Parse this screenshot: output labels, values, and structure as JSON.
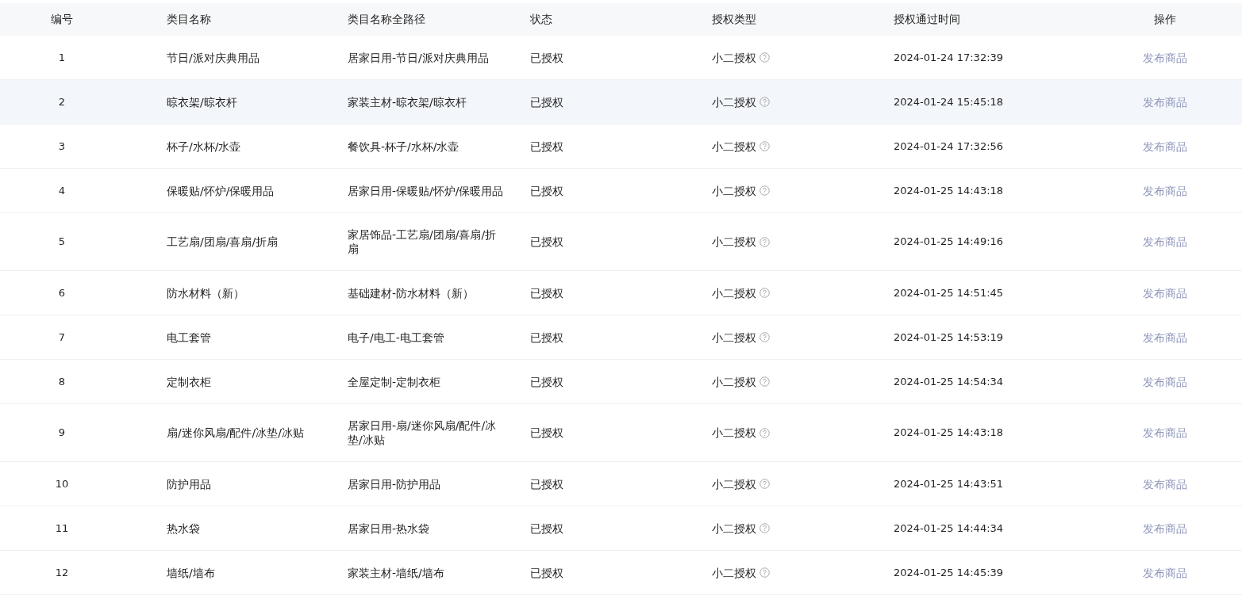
{
  "table": {
    "columns": [
      "编号",
      "类目名称",
      "类目名称全路径",
      "状态",
      "授权类型",
      "授权通过时间",
      "操作"
    ],
    "rows": [
      {
        "number": "1",
        "category": "节日/派对庆典用品",
        "path": "居家日用-节日/派对庆典用品",
        "status": "已授权",
        "auth_type": "小二授权",
        "time": "2024-01-24 17:32:39",
        "action": "发布商品",
        "hovered": false
      },
      {
        "number": "2",
        "category": "晾衣架/晾衣杆",
        "path": "家装主材-晾衣架/晾衣杆",
        "status": "已授权",
        "auth_type": "小二授权",
        "time": "2024-01-24 15:45:18",
        "action": "发布商品",
        "hovered": true
      },
      {
        "number": "3",
        "category": "杯子/水杯/水壶",
        "path": "餐饮具-杯子/水杯/水壶",
        "status": "已授权",
        "auth_type": "小二授权",
        "time": "2024-01-24 17:32:56",
        "action": "发布商品",
        "hovered": false
      },
      {
        "number": "4",
        "category": "保暖贴/怀炉/保暖用品",
        "path": "居家日用-保暖贴/怀炉/保暖用品",
        "status": "已授权",
        "auth_type": "小二授权",
        "time": "2024-01-25 14:43:18",
        "action": "发布商品",
        "hovered": false
      },
      {
        "number": "5",
        "category": "工艺扇/团扇/喜扇/折扇",
        "path": "家居饰品-工艺扇/团扇/喜扇/折扇",
        "status": "已授权",
        "auth_type": "小二授权",
        "time": "2024-01-25 14:49:16",
        "action": "发布商品",
        "hovered": false
      },
      {
        "number": "6",
        "category": "防水材料（新）",
        "path": "基础建材-防水材料（新）",
        "status": "已授权",
        "auth_type": "小二授权",
        "time": "2024-01-25 14:51:45",
        "action": "发布商品",
        "hovered": false
      },
      {
        "number": "7",
        "category": "电工套管",
        "path": "电子/电工-电工套管",
        "status": "已授权",
        "auth_type": "小二授权",
        "time": "2024-01-25 14:53:19",
        "action": "发布商品",
        "hovered": false
      },
      {
        "number": "8",
        "category": "定制衣柜",
        "path": "全屋定制-定制衣柜",
        "status": "已授权",
        "auth_type": "小二授权",
        "time": "2024-01-25 14:54:34",
        "action": "发布商品",
        "hovered": false
      },
      {
        "number": "9",
        "category": "扇/迷你风扇/配件/冰垫/冰贴",
        "path": "居家日用-扇/迷你风扇/配件/冰垫/冰贴",
        "status": "已授权",
        "auth_type": "小二授权",
        "time": "2024-01-25 14:43:18",
        "action": "发布商品",
        "hovered": false
      },
      {
        "number": "10",
        "category": "防护用品",
        "path": "居家日用-防护用品",
        "status": "已授权",
        "auth_type": "小二授权",
        "time": "2024-01-25 14:43:51",
        "action": "发布商品",
        "hovered": false
      },
      {
        "number": "11",
        "category": "热水袋",
        "path": "居家日用-热水袋",
        "status": "已授权",
        "auth_type": "小二授权",
        "time": "2024-01-25 14:44:34",
        "action": "发布商品",
        "hovered": false
      },
      {
        "number": "12",
        "category": "墙纸/墙布",
        "path": "家装主材-墙纸/墙布",
        "status": "已授权",
        "auth_type": "小二授权",
        "time": "2024-01-25 14:45:39",
        "action": "发布商品",
        "hovered": false
      }
    ]
  }
}
